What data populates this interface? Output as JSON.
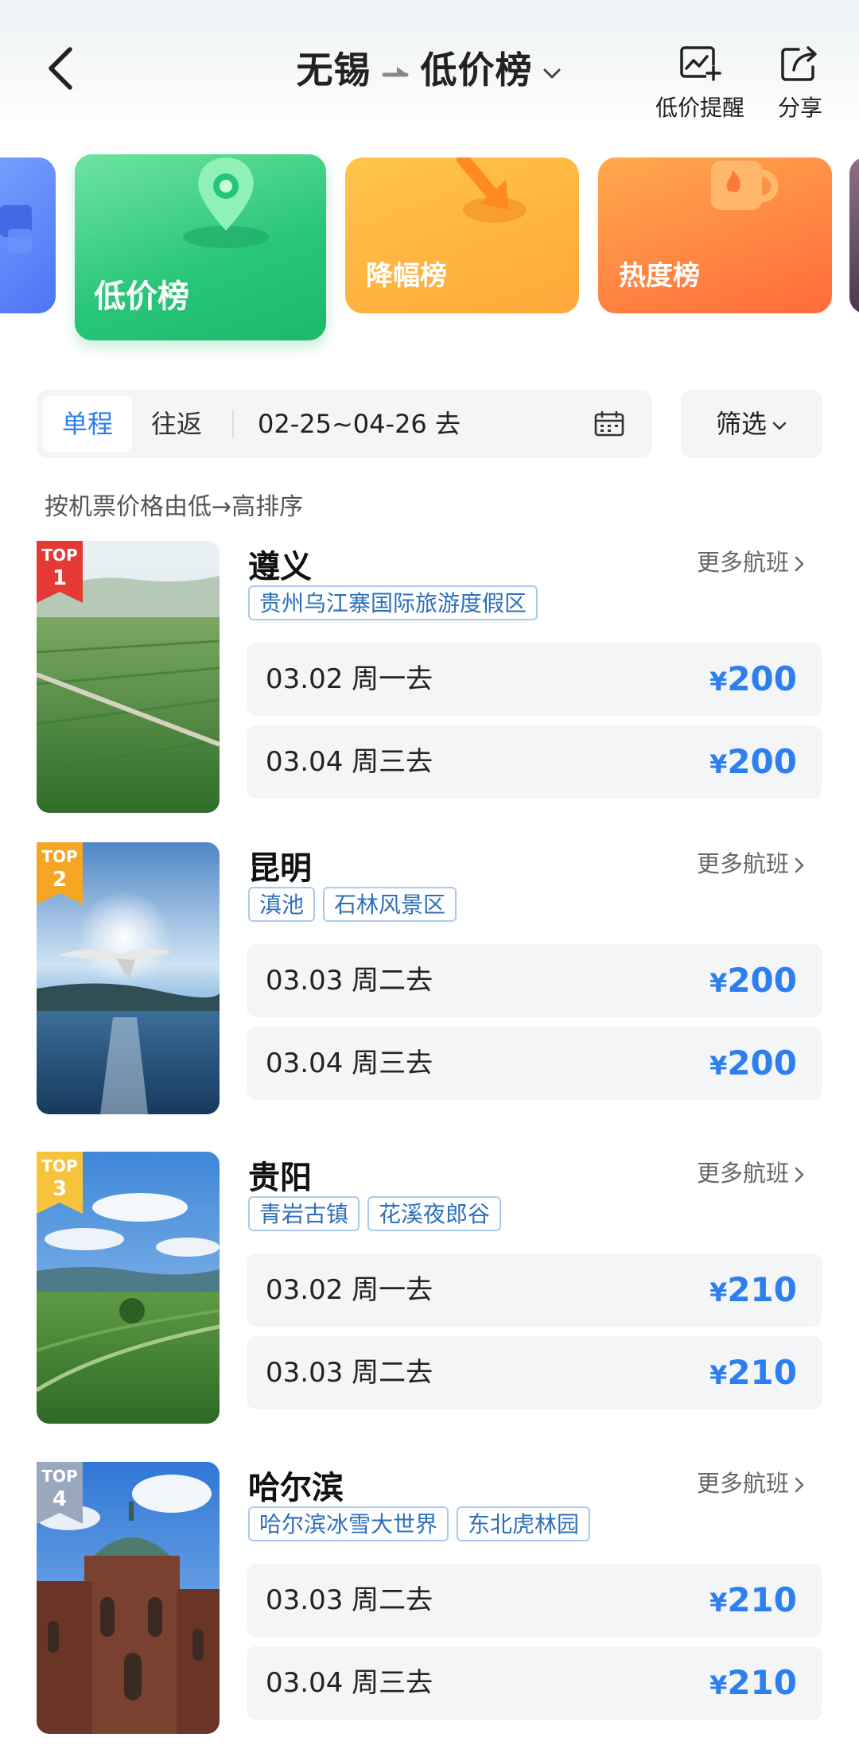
{
  "header": {
    "origin": "无锡",
    "title": "低价榜",
    "alert_label": "低价提醒",
    "share_label": "分享"
  },
  "rank_cards": [
    {
      "label": "低价榜",
      "active": true
    },
    {
      "label": "降幅榜",
      "active": false
    },
    {
      "label": "热度榜",
      "active": false
    }
  ],
  "filter": {
    "one_way_label": "单程",
    "round_trip_label": "往返",
    "selected": "单程",
    "date_range": "02-25~04-26 去",
    "screen_label": "筛选"
  },
  "sort_note": "按机票价格由低→高排序",
  "more_flights_label": "更多航班",
  "destinations": [
    {
      "rank_top": "TOP",
      "rank": "1",
      "badge_color": "#e53935",
      "city": "遵义",
      "tags": [
        "贵州乌江寨国际旅游度假区"
      ],
      "flights": [
        {
          "date": "03.02  周一去",
          "currency": "¥",
          "price": "200"
        },
        {
          "date": "03.04  周三去",
          "currency": "¥",
          "price": "200"
        }
      ]
    },
    {
      "rank_top": "TOP",
      "rank": "2",
      "badge_color": "#f5a623",
      "city": "昆明",
      "tags": [
        "滇池",
        "石林风景区"
      ],
      "flights": [
        {
          "date": "03.03  周二去",
          "currency": "¥",
          "price": "200"
        },
        {
          "date": "03.04  周三去",
          "currency": "¥",
          "price": "200"
        }
      ]
    },
    {
      "rank_top": "TOP",
      "rank": "3",
      "badge_color": "#f7c33a",
      "city": "贵阳",
      "tags": [
        "青岩古镇",
        "花溪夜郎谷"
      ],
      "flights": [
        {
          "date": "03.02  周一去",
          "currency": "¥",
          "price": "210"
        },
        {
          "date": "03.03  周二去",
          "currency": "¥",
          "price": "210"
        }
      ]
    },
    {
      "rank_top": "TOP",
      "rank": "4",
      "badge_color": "#9aa8bd",
      "city": "哈尔滨",
      "tags": [
        "哈尔滨冰雪大世界",
        "东北虎林园"
      ],
      "flights": [
        {
          "date": "03.03  周二去",
          "currency": "¥",
          "price": "210"
        },
        {
          "date": "03.04  周三去",
          "currency": "¥",
          "price": "210"
        }
      ]
    }
  ],
  "colors": {
    "accent_blue": "#2d7ff0",
    "tag_border": "#a9c9ef",
    "card_green": "#27c577",
    "card_orange": "#ffa73a",
    "card_red_orange": "#ff6b3a"
  }
}
